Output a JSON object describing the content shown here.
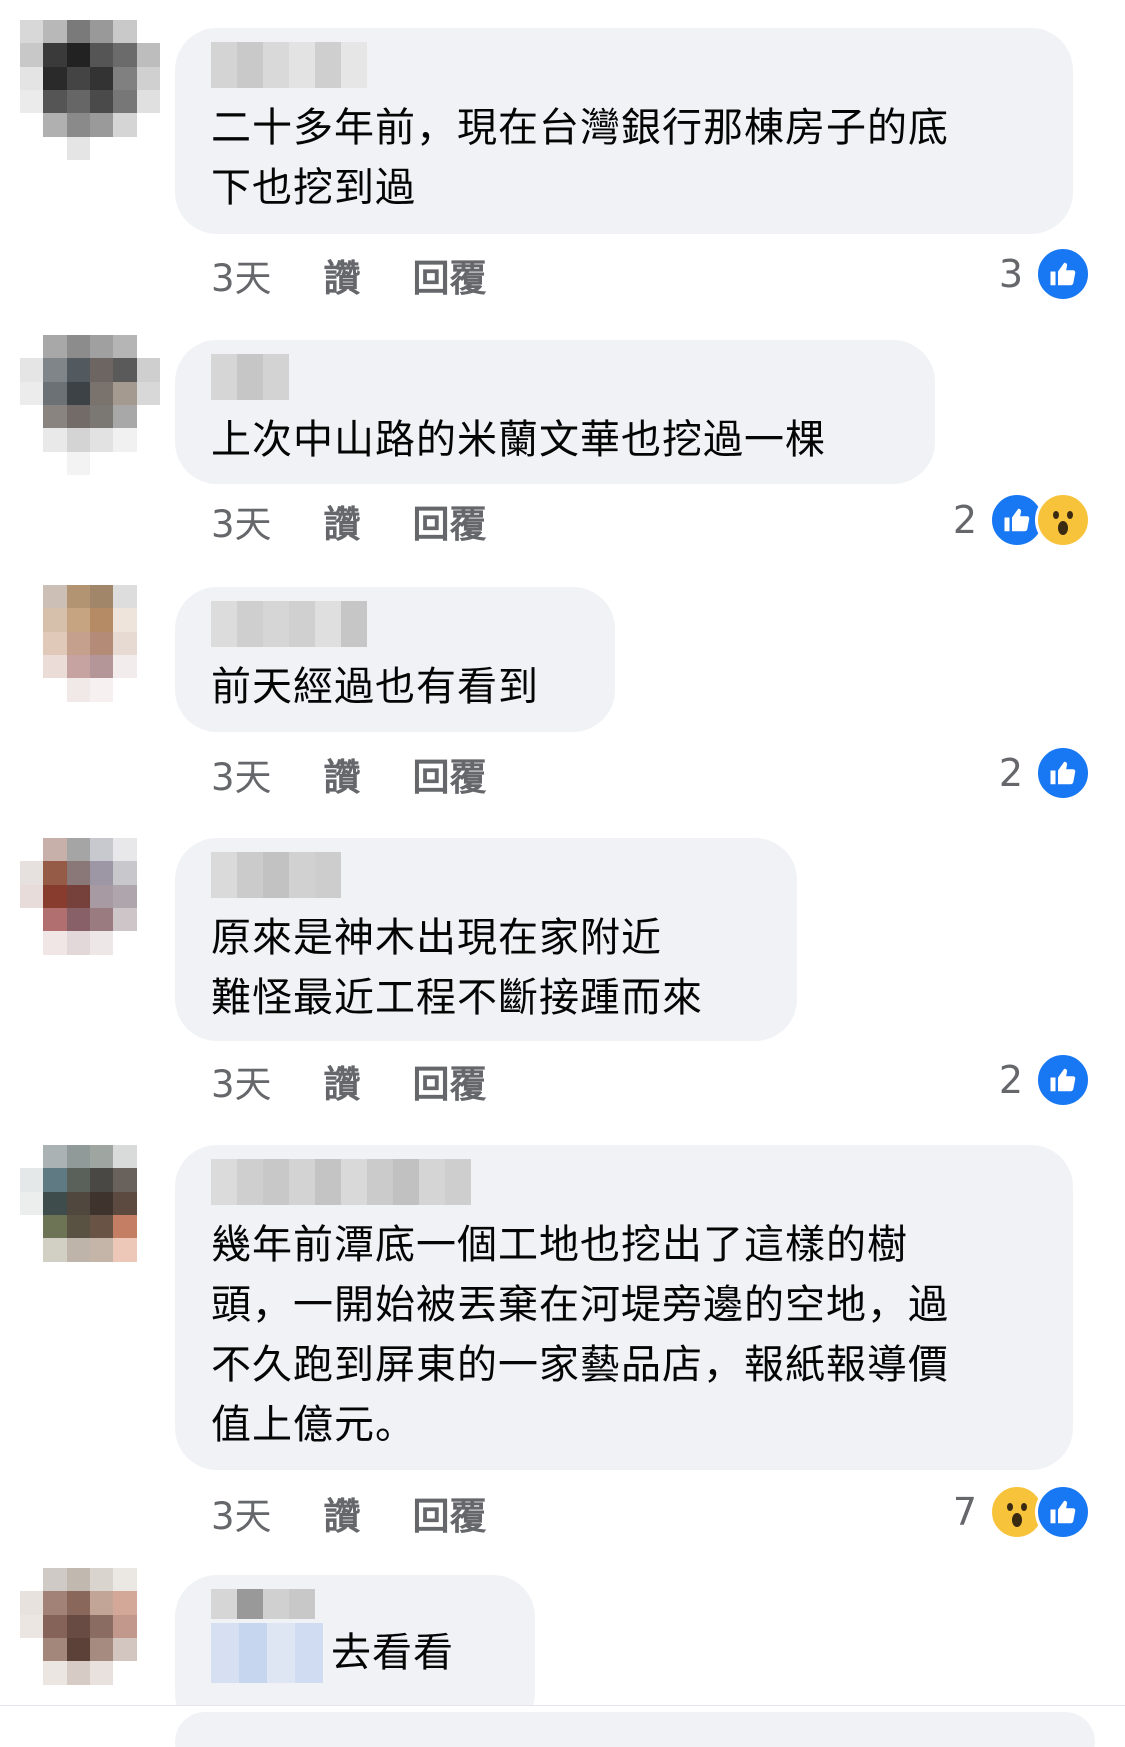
{
  "comments": [
    {
      "text": "二十多年前，現在台灣銀行那棟房子的底\n下也挖到過",
      "time": "3天",
      "like": "讚",
      "reply": "回覆",
      "reaction_count": "3",
      "reactions": [
        "like-icon"
      ]
    },
    {
      "text": "上次中山路的米蘭文華也挖過一棵",
      "time": "3天",
      "like": "讚",
      "reply": "回覆",
      "reaction_count": "2",
      "reactions": [
        "like-icon",
        "wow-icon"
      ]
    },
    {
      "text": "前天經過也有看到",
      "time": "3天",
      "like": "讚",
      "reply": "回覆",
      "reaction_count": "2",
      "reactions": [
        "like-icon"
      ]
    },
    {
      "text": "原來是神木出現在家附近\n難怪最近工程不斷接踵而來",
      "time": "3天",
      "like": "讚",
      "reply": "回覆",
      "reaction_count": "2",
      "reactions": [
        "like-icon"
      ]
    },
    {
      "text": "幾年前潭底一個工地也挖出了這樣的樹\n頭，一開始被丟棄在河堤旁邊的空地，過\n不久跑到屏東的一家藝品店，報紙報導價\n值上億元。",
      "time": "3天",
      "like": "讚",
      "reply": "回覆",
      "reaction_count": "7",
      "reactions": [
        "wow-icon",
        "like-icon"
      ]
    },
    {
      "text": "去看看"
    }
  ],
  "colors": {
    "bubble": "#f0f2f5",
    "like": "#1877f2",
    "wow": "#f7c33b",
    "meta_text": "#65676b"
  }
}
